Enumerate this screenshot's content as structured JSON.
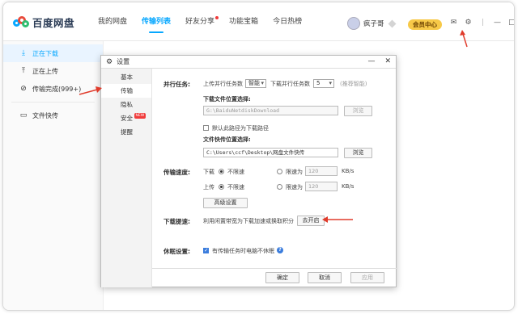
{
  "app": {
    "logo_text": "百度网盘",
    "nav": [
      "我的网盘",
      "传输列表",
      "好友分享",
      "功能宝箱",
      "今日热榜"
    ],
    "active_nav": 1,
    "username": "疯子哥",
    "vip_label": "会员中心"
  },
  "sidebar": {
    "items": [
      {
        "label": "正在下载",
        "icon": "download-icon"
      },
      {
        "label": "正在上传",
        "icon": "upload-icon"
      },
      {
        "label": "传输完成(999+)",
        "icon": "check-circle-icon"
      },
      {
        "label": "文件快传",
        "icon": "monitor-icon"
      }
    ]
  },
  "dialog": {
    "title": "设置",
    "nav": [
      {
        "label": "基本"
      },
      {
        "label": "传输"
      },
      {
        "label": "隐私"
      },
      {
        "label": "安全",
        "badge": "NEW"
      },
      {
        "label": "提醒"
      }
    ],
    "parallel": {
      "label": "并行任务:",
      "upload_text": "上传并行任务数",
      "upload_value": "智能",
      "download_text": "下载并行任务数",
      "download_value": "5",
      "hint": "(推荐智能)"
    },
    "download_dir": {
      "label": "下载文件位置选择:",
      "path": "G:\\BaiduNetdiskDownload",
      "browse": "浏览",
      "default_label": "默认此路径为下载路径"
    },
    "quick_dir": {
      "label": "文件快传位置选择:",
      "path": "C:\\Users\\ccf\\Desktop\\网盘文件快传",
      "browse": "浏览"
    },
    "speed": {
      "label": "传输速度:",
      "download": "下载",
      "upload": "上传",
      "unlimited": "不限速",
      "limit": "限速为",
      "download_limit": "120",
      "upload_limit": "120",
      "unit": "KB/s",
      "advanced": "高级设置"
    },
    "boost": {
      "label": "下载提速:",
      "text": "利用闲置带宽为下载加速或换取积分",
      "button": "去开启"
    },
    "sleep": {
      "label": "休眠设置:",
      "text": "有传输任务时电脑不休眠"
    },
    "footer": {
      "ok": "确定",
      "cancel": "取消",
      "apply": "应用"
    }
  },
  "colors": {
    "accent": "#06a7ff",
    "arrow": "#e03b2b",
    "vip": "#f7c948"
  }
}
